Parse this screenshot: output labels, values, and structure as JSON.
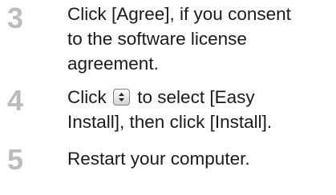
{
  "steps": [
    {
      "number": "3",
      "lines": [
        "Click [Agree], if you consent",
        "to the software license",
        "agreement."
      ]
    },
    {
      "number": "4",
      "line1_before_icon": "Click",
      "line1_after_icon": "to select [Easy",
      "line2": "Install], then click [Install].",
      "icon": "popup-menu-arrows-icon"
    },
    {
      "number": "5",
      "lines": [
        "Restart your computer."
      ]
    }
  ]
}
